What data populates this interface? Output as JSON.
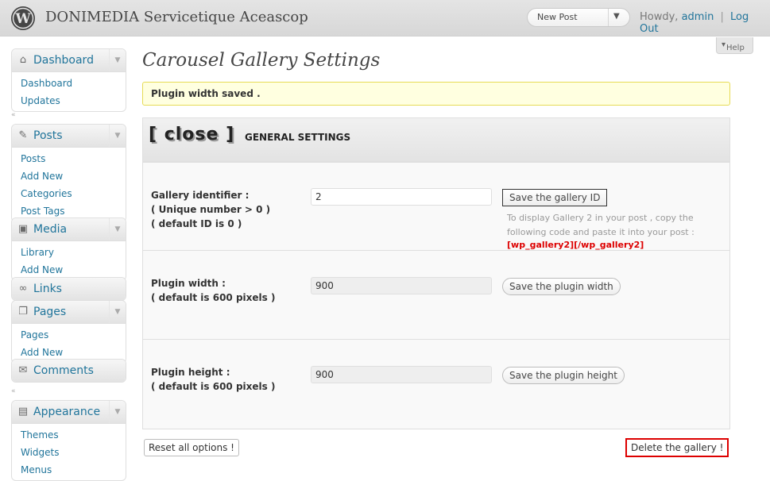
{
  "header": {
    "site_title": "DONIMEDIA Servicetique Aceascop",
    "new_post": "New Post",
    "howdy": "Howdy,",
    "username": "admin",
    "separator": "|",
    "logout": "Log Out",
    "help": "Help"
  },
  "sidebar": {
    "dashboard": {
      "label": "Dashboard",
      "items": [
        "Dashboard",
        "Updates"
      ]
    },
    "posts": {
      "label": "Posts",
      "items": [
        "Posts",
        "Add New",
        "Categories",
        "Post Tags"
      ]
    },
    "media": {
      "label": "Media",
      "items": [
        "Library",
        "Add New"
      ]
    },
    "links": {
      "label": "Links"
    },
    "pages": {
      "label": "Pages",
      "items": [
        "Pages",
        "Add New"
      ]
    },
    "comments": {
      "label": "Comments"
    },
    "appearance": {
      "label": "Appearance",
      "items": [
        "Themes",
        "Widgets",
        "Menus"
      ]
    }
  },
  "main": {
    "page_title": "Carousel Gallery Settings",
    "notice": "Plugin width saved .",
    "close_button": "[ close ]",
    "panel_title": "GENERAL SETTINGS",
    "gallery_id": {
      "label_lines": [
        "Gallery identifier :",
        "( Unique number > 0 )",
        "( default ID is 0 )"
      ],
      "value": "2",
      "button": "Save the gallery ID",
      "hint": "To display Gallery 2 in your post , copy the following code and paste it into your post :",
      "code": "[wp_gallery2][/wp_gallery2]"
    },
    "plugin_width": {
      "label_lines": [
        "Plugin width :",
        "( default is 600 pixels )"
      ],
      "value": "900",
      "button": "Save the plugin width"
    },
    "plugin_height": {
      "label_lines": [
        "Plugin height :",
        "( default is 600 pixels )"
      ],
      "value": "900",
      "button": "Save the plugin height"
    },
    "reset_button": "Reset all options !",
    "delete_button": "Delete the gallery !"
  }
}
